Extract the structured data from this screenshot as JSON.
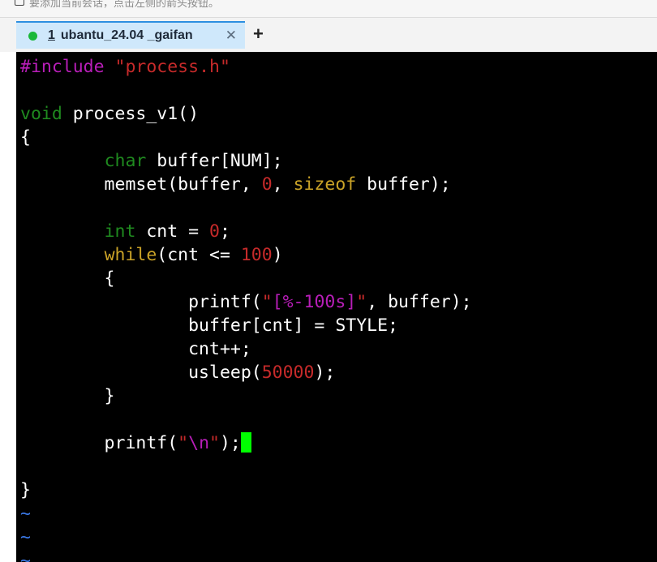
{
  "topbar": {
    "hint_text": "要添加当前会话，点击左侧的箭头按钮。"
  },
  "tabs": [
    {
      "number": "1",
      "title": "ubantu_24.04 _gaifan",
      "status_color": "#1ab839"
    }
  ],
  "new_tab_label": "+",
  "editor": {
    "lines": {
      "l1a": "#include",
      "l1b": " ",
      "l1c": "\"process.h\"",
      "l3a": "void",
      "l3b": " process_v1()",
      "l4": "{",
      "l5a": "        ",
      "l5b": "char",
      "l5c": " buffer[NUM];",
      "l6a": "        memset(buffer, ",
      "l6b": "0",
      "l6c": ", ",
      "l6d": "sizeof",
      "l6e": " buffer);",
      "l8a": "        ",
      "l8b": "int",
      "l8c": " cnt = ",
      "l8d": "0",
      "l8e": ";",
      "l9a": "        ",
      "l9b": "while",
      "l9c": "(cnt <= ",
      "l9d": "100",
      "l9e": ")",
      "l10": "        {",
      "l11a": "                printf(",
      "l11b": "\"",
      "l11c": "[%-100s]",
      "l11d": "\"",
      "l11e": ", buffer);",
      "l12": "                buffer[cnt] = STYLE;",
      "l13": "                cnt++;",
      "l14a": "                usleep(",
      "l14b": "50000",
      "l14c": ");",
      "l15": "        }",
      "l17a": "        printf(",
      "l17b": "\"",
      "l17c": "\\n",
      "l17d": "\"",
      "l17e": ");",
      "l19": "}",
      "tilde": "~"
    },
    "cursor_color": "#00ff00"
  }
}
